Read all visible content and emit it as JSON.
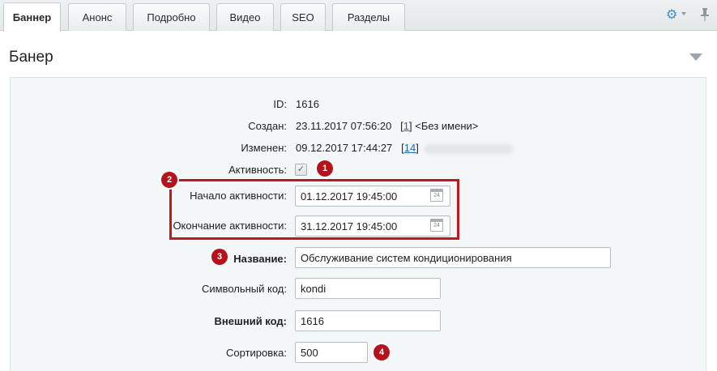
{
  "tabs": [
    {
      "label": "Баннер",
      "active": true
    },
    {
      "label": "Анонс"
    },
    {
      "label": "Подробно"
    },
    {
      "label": "Видео"
    },
    {
      "label": "SEO"
    },
    {
      "label": "Разделы"
    }
  ],
  "toolbar": {
    "settings_icon": "gear-icon",
    "pin_icon": "pin-icon"
  },
  "section": {
    "title": "Банер"
  },
  "form": {
    "id_label": "ID:",
    "id_value": "1616",
    "created_label": "Создан:",
    "created_value": "23.11.2017 07:56:20",
    "created_user_open": "[",
    "created_user_link": "1",
    "created_user_close": "] <Без имени>",
    "changed_label": "Изменен:",
    "changed_value": "09.12.2017 17:44:27",
    "changed_user_open": "[",
    "changed_user_link": "14",
    "changed_user_close": "]",
    "active_label": "Активность:",
    "active_checked": true,
    "active_from_label": "Начало активности:",
    "active_from_value": "01.12.2017 19:45:00",
    "active_to_label": "Окончание активности:",
    "active_to_value": "31.12.2017 19:45:00",
    "name_label": "Название:",
    "name_value": "Обслуживание систем кондиционирования",
    "code_label": "Символьный код:",
    "code_value": "kondi",
    "xml_id_label": "Внешний код:",
    "xml_id_value": "1616",
    "sort_label": "Сортировка:",
    "sort_value": "500"
  },
  "annotations": {
    "b1": "1",
    "b2": "2",
    "b3": "3",
    "b4": "4",
    "color": "#b5121b"
  }
}
